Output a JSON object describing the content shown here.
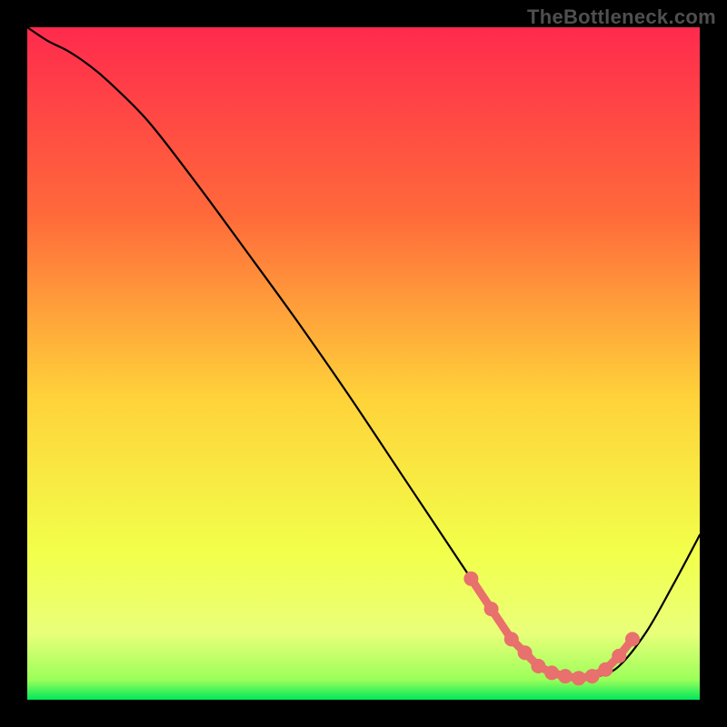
{
  "watermark": "TheBottleneck.com",
  "chart_data": {
    "type": "line",
    "title": "",
    "xlabel": "",
    "ylabel": "",
    "xlim": [
      0,
      100
    ],
    "ylim": [
      0,
      100
    ],
    "grid": false,
    "legend": false,
    "gradient_colors": {
      "top": "#ff2a4d",
      "mid_upper": "#ff7a3a",
      "mid": "#ffd23a",
      "mid_lower": "#f6ff4a",
      "bottom": "#00e85a"
    },
    "series": [
      {
        "name": "bottleneck-curve",
        "x": [
          0,
          3,
          6,
          9,
          12,
          18,
          25,
          32,
          40,
          48,
          56,
          62,
          66,
          70,
          73,
          76,
          79,
          82,
          85,
          88,
          92,
          96,
          100
        ],
        "y": [
          100,
          98,
          96.5,
          94.5,
          92,
          86,
          77,
          67.5,
          56.5,
          45,
          33,
          24,
          18,
          12,
          8,
          5,
          3.5,
          3,
          3.5,
          5,
          10,
          17,
          24.5
        ],
        "color": "#000000"
      }
    ],
    "markers": [
      {
        "name": "highlight-band",
        "x": [
          66,
          69,
          72,
          74,
          76,
          78,
          80,
          82,
          84,
          86,
          88,
          90
        ],
        "y": [
          18,
          13.5,
          9,
          7,
          5,
          4,
          3.5,
          3.2,
          3.5,
          4.5,
          6.5,
          9
        ],
        "color": "#e8706d",
        "size": 8
      }
    ]
  }
}
